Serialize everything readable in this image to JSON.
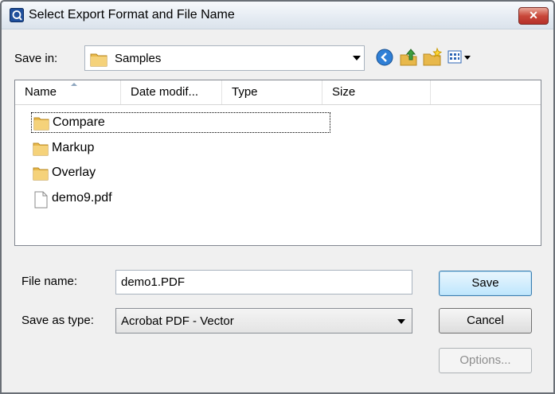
{
  "window": {
    "title": "Select Export Format and File Name",
    "close_label": "✕"
  },
  "toolbar": {
    "save_in_label": "Save in:",
    "save_in_value": "Samples",
    "icons": [
      "back-icon",
      "up-folder-icon",
      "new-folder-icon",
      "views-menu-icon"
    ]
  },
  "filelist": {
    "columns": [
      "Name",
      "Date modif...",
      "Type",
      "Size"
    ],
    "items": [
      {
        "name": "Compare",
        "kind": "folder"
      },
      {
        "name": "Markup",
        "kind": "folder"
      },
      {
        "name": "Overlay",
        "kind": "folder"
      },
      {
        "name": "demo9.pdf",
        "kind": "file"
      }
    ]
  },
  "form": {
    "file_name_label": "File name:",
    "file_name_value": "demo1.PDF",
    "save_as_type_label": "Save as type:",
    "save_as_type_value": "Acrobat PDF - Vector"
  },
  "buttons": {
    "save": "Save",
    "cancel": "Cancel",
    "options": "Options..."
  },
  "colors": {
    "accent": "#3c7fb1",
    "folder": "#e8b84a",
    "close": "#c9483a"
  }
}
